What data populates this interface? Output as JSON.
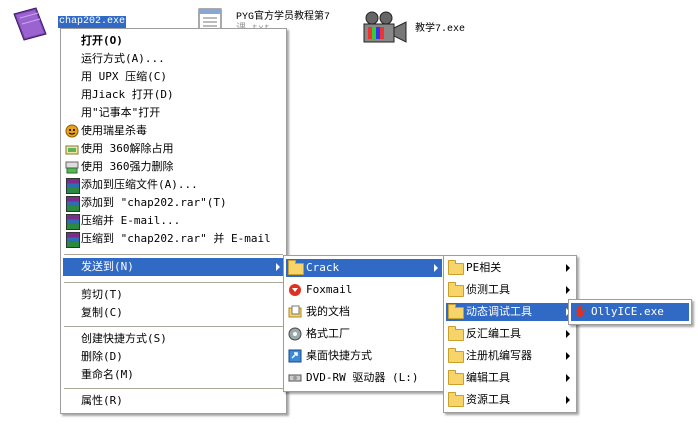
{
  "desktop": {
    "icon1_label": "chap202.exe",
    "icon2_label_line1": "PYG官方学员教程第7",
    "icon2_label_line2": "课.txt",
    "icon3_label": "教学7.exe"
  },
  "context_menu": {
    "items": [
      {
        "label": "打开(O)"
      },
      {
        "label": "运行方式(A)..."
      },
      {
        "label": "用 UPX 压缩(C)"
      },
      {
        "label": "用Jiack 打开(D)"
      },
      {
        "label": "用\"记事本\"打开"
      },
      {
        "label": "使用瑞星杀毒"
      },
      {
        "label": "使用 360解除占用"
      },
      {
        "label": "使用 360强力删除"
      },
      {
        "label": "添加到压缩文件(A)..."
      },
      {
        "label": "添加到 \"chap202.rar\"(T)"
      },
      {
        "label": "压缩并 E-mail..."
      },
      {
        "label": "压缩到 \"chap202.rar\" 并 E-mail"
      },
      {
        "label": "发送到(N)"
      },
      {
        "label": "剪切(T)"
      },
      {
        "label": "复制(C)"
      },
      {
        "label": "创建快捷方式(S)"
      },
      {
        "label": "删除(D)"
      },
      {
        "label": "重命名(M)"
      },
      {
        "label": "属性(R)"
      }
    ]
  },
  "sendto_menu": {
    "items": [
      {
        "label": "Crack"
      },
      {
        "label": "Foxmail"
      },
      {
        "label": "我的文档"
      },
      {
        "label": "格式工厂"
      },
      {
        "label": "桌面快捷方式"
      },
      {
        "label": "DVD-RW 驱动器 (L:)"
      }
    ]
  },
  "crack_menu": {
    "items": [
      {
        "label": "PE相关"
      },
      {
        "label": "侦测工具"
      },
      {
        "label": "动态调试工具"
      },
      {
        "label": "反汇编工具"
      },
      {
        "label": "注册机编写器"
      },
      {
        "label": "编辑工具"
      },
      {
        "label": "资源工具"
      }
    ]
  },
  "debug_menu": {
    "items": [
      {
        "label": "OllyICE.exe"
      }
    ]
  },
  "colors": {
    "highlight": "#316ac5",
    "menu_bg": "#ffffff"
  }
}
